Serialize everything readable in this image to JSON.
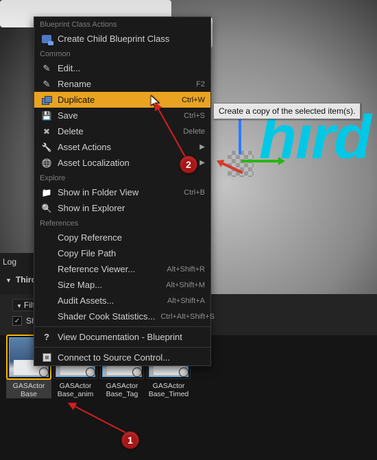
{
  "markers": {
    "m1": "1",
    "m2": "2"
  },
  "tooltip": "Create a copy of the selected item(s).",
  "viewport_text": "hird",
  "left": {
    "log": "Log",
    "third": "Third"
  },
  "toolbar": {
    "filters": "Filt",
    "show": "Sho"
  },
  "context_menu": {
    "sections": {
      "blueprint": "Blueprint Class Actions",
      "common": "Common",
      "explore": "Explore",
      "references": "References"
    },
    "create_child": "Create Child Blueprint Class",
    "edit": "Edit...",
    "rename": "Rename",
    "rename_sc": "F2",
    "duplicate": "Duplicate",
    "duplicate_sc": "Ctrl+W",
    "save": "Save",
    "save_sc": "Ctrl+S",
    "delete": "Delete",
    "delete_sc": "Delete",
    "asset_actions": "Asset Actions",
    "asset_loc": "Asset Localization",
    "show_folder": "Show in Folder View",
    "show_folder_sc": "Ctrl+B",
    "show_explorer": "Show in Explorer",
    "copy_ref": "Copy Reference",
    "copy_path": "Copy File Path",
    "ref_viewer": "Reference Viewer...",
    "ref_viewer_sc": "Alt+Shift+R",
    "size_map": "Size Map...",
    "size_map_sc": "Alt+Shift+M",
    "audit": "Audit Assets...",
    "audit_sc": "Alt+Shift+A",
    "shader_cook": "Shader Cook Statistics...",
    "shader_cook_sc": "Ctrl+Alt+Shift+S",
    "view_doc": "View Documentation - Blueprint",
    "scm": "Connect to Source Control..."
  },
  "assets": [
    {
      "line1": "GASActor",
      "line2": "Base"
    },
    {
      "line1": "GASActor",
      "line2": "Base_anim"
    },
    {
      "line1": "GASActor",
      "line2": "Base_Tag"
    },
    {
      "line1": "GASActor",
      "line2": "Base_Timed"
    }
  ]
}
